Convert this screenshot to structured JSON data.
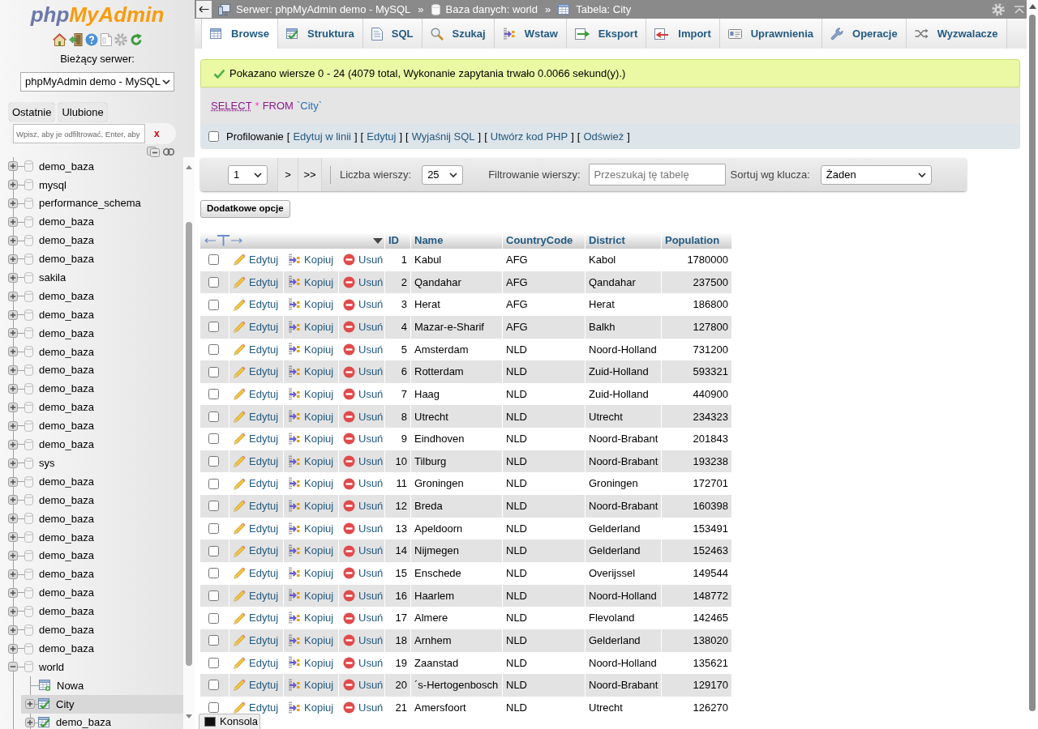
{
  "sidebar": {
    "logo": [
      "php",
      "MyAdmin"
    ],
    "server_label": "Bieżący serwer:",
    "server_select": "phpMyAdmin demo - MySQL",
    "buttons": [
      "Ostatnie",
      "Ulubione"
    ],
    "filter": {
      "placeholder": "Wpisz, aby je odfiltrować, Enter, aby",
      "clear": "x"
    },
    "tree": [
      {
        "kind": "database",
        "label": "demo_baza",
        "expanded": false,
        "selected": false
      },
      {
        "kind": "database",
        "label": "mysql",
        "expanded": false,
        "selected": false
      },
      {
        "kind": "database",
        "label": "performance_schema",
        "expanded": false,
        "selected": false
      },
      {
        "kind": "database",
        "label": "demo_baza",
        "expanded": false,
        "selected": false
      },
      {
        "kind": "database",
        "label": "demo_baza",
        "expanded": false,
        "selected": false
      },
      {
        "kind": "database",
        "label": "demo_baza",
        "expanded": false,
        "selected": false
      },
      {
        "kind": "database",
        "label": "sakila",
        "expanded": false,
        "selected": false
      },
      {
        "kind": "database",
        "label": "demo_baza",
        "expanded": false,
        "selected": false
      },
      {
        "kind": "database",
        "label": "demo_baza",
        "expanded": false,
        "selected": false
      },
      {
        "kind": "database",
        "label": "demo_baza",
        "expanded": false,
        "selected": false
      },
      {
        "kind": "database",
        "label": "demo_baza",
        "expanded": false,
        "selected": false
      },
      {
        "kind": "database",
        "label": "demo_baza",
        "expanded": false,
        "selected": false
      },
      {
        "kind": "database",
        "label": "demo_baza",
        "expanded": false,
        "selected": false
      },
      {
        "kind": "database",
        "label": "demo_baza",
        "expanded": false,
        "selected": false
      },
      {
        "kind": "database",
        "label": "demo_baza",
        "expanded": false,
        "selected": false
      },
      {
        "kind": "database",
        "label": "demo_baza",
        "expanded": false,
        "selected": false
      },
      {
        "kind": "database",
        "label": "sys",
        "expanded": false,
        "selected": false
      },
      {
        "kind": "database",
        "label": "demo_baza",
        "expanded": false,
        "selected": false
      },
      {
        "kind": "database",
        "label": "demo_baza",
        "expanded": false,
        "selected": false
      },
      {
        "kind": "database",
        "label": "demo_baza",
        "expanded": false,
        "selected": false
      },
      {
        "kind": "database",
        "label": "demo_baza",
        "expanded": false,
        "selected": false
      },
      {
        "kind": "database",
        "label": "demo_baza",
        "expanded": false,
        "selected": false
      },
      {
        "kind": "database",
        "label": "demo_baza",
        "expanded": false,
        "selected": false
      },
      {
        "kind": "database",
        "label": "demo_baza",
        "expanded": false,
        "selected": false
      },
      {
        "kind": "database",
        "label": "demo_baza",
        "expanded": false,
        "selected": false
      },
      {
        "kind": "database",
        "label": "demo_baza",
        "expanded": false,
        "selected": false
      },
      {
        "kind": "database",
        "label": "demo_baza",
        "expanded": false,
        "selected": false
      },
      {
        "kind": "database",
        "label": "world",
        "expanded": true,
        "selected": false,
        "children": [
          {
            "kind": "new",
            "label": "Nowa",
            "selected": false
          },
          {
            "kind": "table",
            "label": "City",
            "expanded": false,
            "selected": true
          },
          {
            "kind": "table",
            "label": "demo_baza",
            "expanded": false,
            "selected": false
          }
        ]
      }
    ]
  },
  "breadcrumb": [
    {
      "kind": "server",
      "label": "Serwer: phpMyAdmin demo - MySQL"
    },
    {
      "kind": "separator",
      "label": "»"
    },
    {
      "kind": "database",
      "label": "Baza danych: world"
    },
    {
      "kind": "separator",
      "label": "»"
    },
    {
      "kind": "table",
      "label": "Tabela: City"
    }
  ],
  "tabs": [
    {
      "label": "Browse",
      "selected": true
    },
    {
      "label": "Struktura",
      "selected": false
    },
    {
      "label": "SQL",
      "selected": false
    },
    {
      "label": "Szukaj",
      "selected": false
    },
    {
      "label": "Wstaw",
      "selected": false
    },
    {
      "label": "Eksport",
      "selected": false
    },
    {
      "label": "Import",
      "selected": false
    },
    {
      "label": "Uprawnienia",
      "selected": false
    },
    {
      "label": "Operacje",
      "selected": false
    },
    {
      "label": "Wyzwalacze",
      "selected": false
    }
  ],
  "success_message": "Pokazano wiersze 0 - 24 (4079 total, Wykonanie zapytania trwało 0.0066 sekund(y).)",
  "sql_query": [
    {
      "kind": "keyword_link",
      "text": "SELECT"
    },
    {
      "kind": "operator",
      "text": "*"
    },
    {
      "kind": "keyword",
      "text": "FROM"
    },
    {
      "kind": "identifier",
      "text": "`City`"
    }
  ],
  "profiling": {
    "checked": false,
    "label": "Profilowanie",
    "links": [
      {
        "open": "[",
        "label": "Edytuj w linii",
        "close": "]"
      },
      {
        "open": "[",
        "label": "Edytuj",
        "close": "]"
      },
      {
        "open": "[",
        "label": "Wyjaśnij SQL",
        "close": "]"
      },
      {
        "open": "[",
        "label": "Utwórz kod PHP",
        "close": "]"
      },
      {
        "open": "[",
        "label": "Odśwież",
        "close": "]"
      }
    ]
  },
  "navigation": {
    "page": "1",
    "next": ">",
    "last": ">>",
    "rows_label": "Liczba wierszy:",
    "rows": "25",
    "filter": {
      "label": "Filtrowanie wierszy:",
      "placeholder": "Przeszukaj tę tabelę"
    },
    "sort_label": "Sortuj wg klucza:",
    "sort": "Żaden"
  },
  "more_options_button": "Dodatkowe opcje",
  "table": {
    "columns": [
      "ID",
      "Name",
      "CountryCode",
      "District",
      "Population"
    ],
    "rows": [
      {
        "checked": false,
        "actions": [
          "Edytuj",
          "Kopiuj",
          "Usuń"
        ],
        "cells": [
          "1",
          "Kabul",
          "AFG",
          "Kabol",
          "1780000"
        ]
      },
      {
        "checked": false,
        "actions": [
          "Edytuj",
          "Kopiuj",
          "Usuń"
        ],
        "cells": [
          "2",
          "Qandahar",
          "AFG",
          "Qandahar",
          "237500"
        ]
      },
      {
        "checked": false,
        "actions": [
          "Edytuj",
          "Kopiuj",
          "Usuń"
        ],
        "cells": [
          "3",
          "Herat",
          "AFG",
          "Herat",
          "186800"
        ]
      },
      {
        "checked": false,
        "actions": [
          "Edytuj",
          "Kopiuj",
          "Usuń"
        ],
        "cells": [
          "4",
          "Mazar-e-Sharif",
          "AFG",
          "Balkh",
          "127800"
        ]
      },
      {
        "checked": false,
        "actions": [
          "Edytuj",
          "Kopiuj",
          "Usuń"
        ],
        "cells": [
          "5",
          "Amsterdam",
          "NLD",
          "Noord-Holland",
          "731200"
        ]
      },
      {
        "checked": false,
        "actions": [
          "Edytuj",
          "Kopiuj",
          "Usuń"
        ],
        "cells": [
          "6",
          "Rotterdam",
          "NLD",
          "Zuid-Holland",
          "593321"
        ]
      },
      {
        "checked": false,
        "actions": [
          "Edytuj",
          "Kopiuj",
          "Usuń"
        ],
        "cells": [
          "7",
          "Haag",
          "NLD",
          "Zuid-Holland",
          "440900"
        ]
      },
      {
        "checked": false,
        "actions": [
          "Edytuj",
          "Kopiuj",
          "Usuń"
        ],
        "cells": [
          "8",
          "Utrecht",
          "NLD",
          "Utrecht",
          "234323"
        ]
      },
      {
        "checked": false,
        "actions": [
          "Edytuj",
          "Kopiuj",
          "Usuń"
        ],
        "cells": [
          "9",
          "Eindhoven",
          "NLD",
          "Noord-Brabant",
          "201843"
        ]
      },
      {
        "checked": false,
        "actions": [
          "Edytuj",
          "Kopiuj",
          "Usuń"
        ],
        "cells": [
          "10",
          "Tilburg",
          "NLD",
          "Noord-Brabant",
          "193238"
        ]
      },
      {
        "checked": false,
        "actions": [
          "Edytuj",
          "Kopiuj",
          "Usuń"
        ],
        "cells": [
          "11",
          "Groningen",
          "NLD",
          "Groningen",
          "172701"
        ]
      },
      {
        "checked": false,
        "actions": [
          "Edytuj",
          "Kopiuj",
          "Usuń"
        ],
        "cells": [
          "12",
          "Breda",
          "NLD",
          "Noord-Brabant",
          "160398"
        ]
      },
      {
        "checked": false,
        "actions": [
          "Edytuj",
          "Kopiuj",
          "Usuń"
        ],
        "cells": [
          "13",
          "Apeldoorn",
          "NLD",
          "Gelderland",
          "153491"
        ]
      },
      {
        "checked": false,
        "actions": [
          "Edytuj",
          "Kopiuj",
          "Usuń"
        ],
        "cells": [
          "14",
          "Nijmegen",
          "NLD",
          "Gelderland",
          "152463"
        ]
      },
      {
        "checked": false,
        "actions": [
          "Edytuj",
          "Kopiuj",
          "Usuń"
        ],
        "cells": [
          "15",
          "Enschede",
          "NLD",
          "Overijssel",
          "149544"
        ]
      },
      {
        "checked": false,
        "actions": [
          "Edytuj",
          "Kopiuj",
          "Usuń"
        ],
        "cells": [
          "16",
          "Haarlem",
          "NLD",
          "Noord-Holland",
          "148772"
        ]
      },
      {
        "checked": false,
        "actions": [
          "Edytuj",
          "Kopiuj",
          "Usuń"
        ],
        "cells": [
          "17",
          "Almere",
          "NLD",
          "Flevoland",
          "142465"
        ]
      },
      {
        "checked": false,
        "actions": [
          "Edytuj",
          "Kopiuj",
          "Usuń"
        ],
        "cells": [
          "18",
          "Arnhem",
          "NLD",
          "Gelderland",
          "138020"
        ]
      },
      {
        "checked": false,
        "actions": [
          "Edytuj",
          "Kopiuj",
          "Usuń"
        ],
        "cells": [
          "19",
          "Zaanstad",
          "NLD",
          "Noord-Holland",
          "135621"
        ]
      },
      {
        "checked": false,
        "actions": [
          "Edytuj",
          "Kopiuj",
          "Usuń"
        ],
        "cells": [
          "20",
          "´s-Hertogenbosch",
          "NLD",
          "Noord-Brabant",
          "129170"
        ]
      },
      {
        "checked": false,
        "actions": [
          "Edytuj",
          "Kopiuj",
          "Usuń"
        ],
        "cells": [
          "21",
          "Amersfoort",
          "NLD",
          "Utrecht",
          "126270"
        ]
      }
    ]
  },
  "console_button": "Konsola"
}
